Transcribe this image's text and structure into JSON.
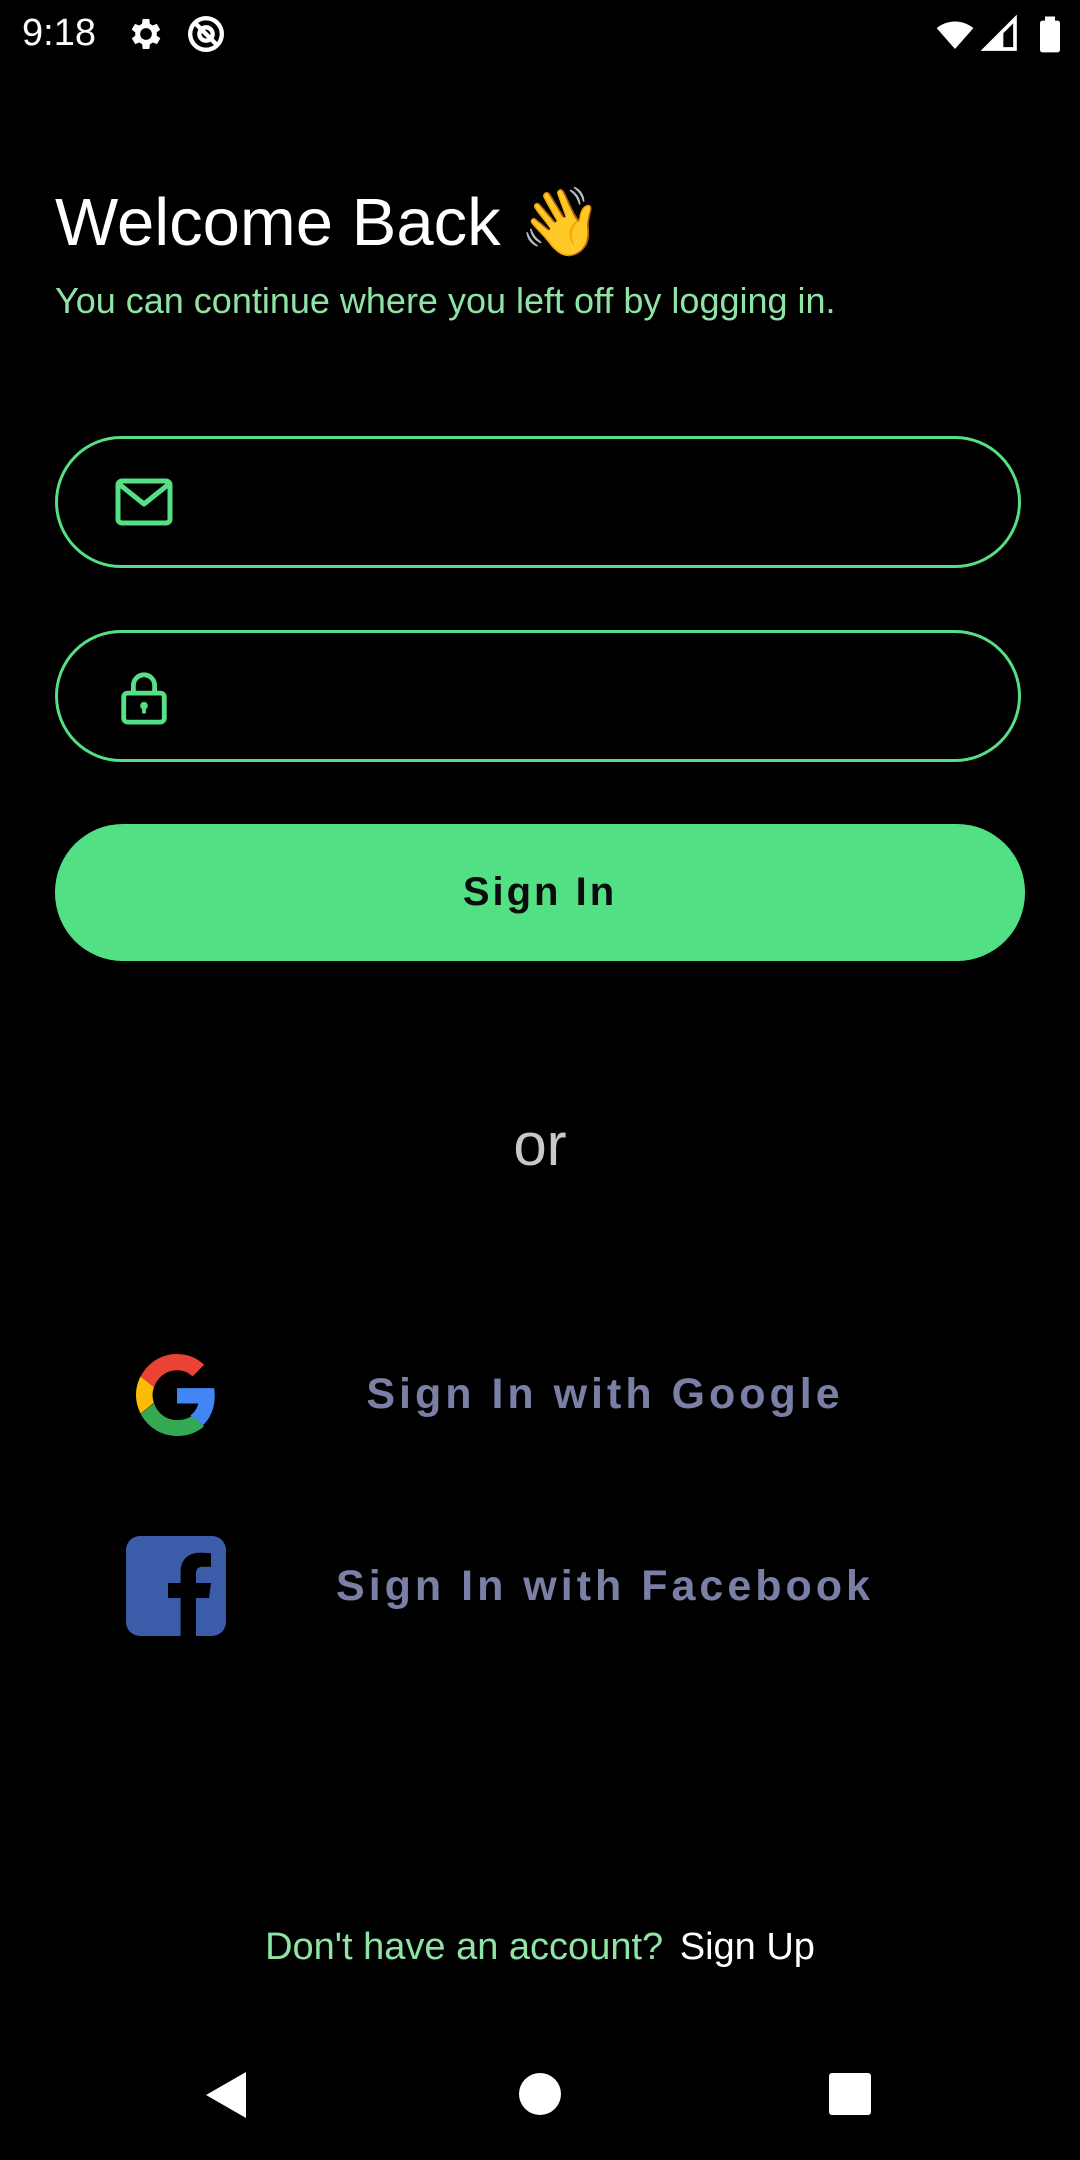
{
  "status_bar": {
    "time": "9:18",
    "left_icons": [
      "gear-icon",
      "at-sign-icon"
    ],
    "right_icons": [
      "wifi-icon",
      "signal-icon",
      "battery-icon"
    ]
  },
  "header": {
    "title": "Welcome Back 👋",
    "subtitle": "You can continue where you left off by logging in."
  },
  "form": {
    "email_value": "",
    "password_value": "",
    "email_icon": "envelope-icon",
    "password_icon": "lock-icon",
    "sign_in_label": "Sign In"
  },
  "separator": "or",
  "social": {
    "google_label": "Sign In with Google",
    "facebook_label": "Sign In with Facebook"
  },
  "footer": {
    "prompt": "Don't have an account?",
    "link": "Sign Up"
  },
  "nav_bar": {
    "buttons": [
      "back-icon",
      "home-icon",
      "recents-icon"
    ]
  },
  "colors": {
    "accent": "#53e085",
    "accent_text": "#8fe3a5",
    "social_text": "#7a7fa5",
    "background": "#000000"
  }
}
